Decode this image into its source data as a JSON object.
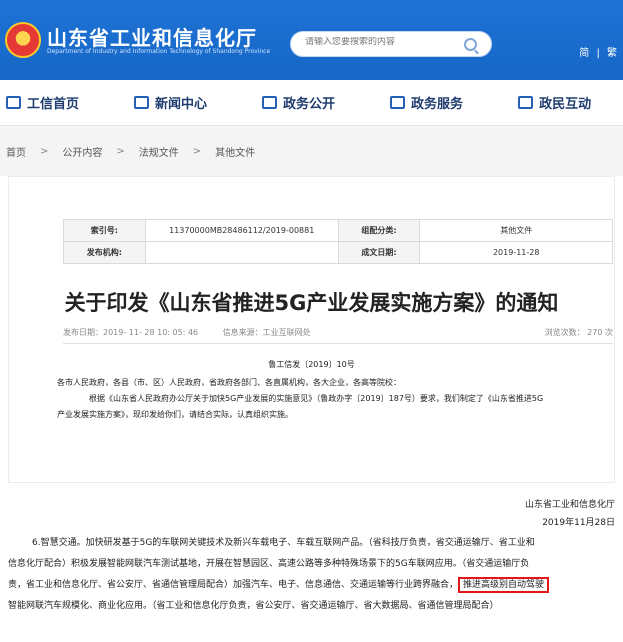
{
  "header": {
    "title": "山东省工业和信息化厅",
    "subtitle": "Department of Industry and Information Technology of Shandong Province",
    "search_placeholder": "请输入您要搜索的内容",
    "lang_links": [
      "简",
      "繁"
    ]
  },
  "nav": {
    "items": [
      {
        "label": "工信首页",
        "icon": "home-icon"
      },
      {
        "label": "新闻中心",
        "icon": "news-icon"
      },
      {
        "label": "政务公开",
        "icon": "monitor-icon"
      },
      {
        "label": "政务服务",
        "icon": "service-icon"
      },
      {
        "label": "政民互动",
        "icon": "interact-icon"
      }
    ]
  },
  "breadcrumb": [
    "首页",
    "公开内容",
    "法规文件",
    "其他文件"
  ],
  "meta": {
    "index_label": "索引号:",
    "index_value": "11370000MB28486112/2019-00881",
    "category_label": "组配分类:",
    "category_value": "其他文件",
    "issuer_label": "发布机构:",
    "issuer_value": "",
    "date_label": "成文日期:",
    "date_value": "2019-11-28"
  },
  "article": {
    "title": "关于印发《山东省推进5G产业发展实施方案》的通知",
    "publish_time": "发布日期：2019- 11- 28 10: 05: 46",
    "source": "信息来源：工业互联网处",
    "views": "浏览次数： 270   次",
    "doc_no": "鲁工信发〔2019〕10号",
    "salutation": "各市人民政府，各县（市、区）人民政府，省政府各部门、各直属机构，各大企业，各高等院校：",
    "body_line1": "根据《山东省人民政府办公厅关于加快5G产业发展的实施意见》（鲁政办字〔2019〕187号）要求，我们制定了《山东省推进5G",
    "body_line2": "产业发展实施方案》，现印发给你们，请结合实际，认真组织实施。"
  },
  "signature": {
    "org": "山东省工业和信息化厅",
    "date": "2019年11月28日"
  },
  "excerpt": {
    "line1": "6.智慧交通。加快研发基于5G的车联网关键技术及新兴车载电子、车载互联网产品。（省科技厅负责，省交通运输厅、省工业和",
    "line2": "信息化厅配合）积极发展智能网联汽车测试基地，开展在智慧园区、高速公路等多种特殊场景下的5G车联网应用。（省交通运输厅负",
    "line3": "责，省工业和信息化厅、省公安厅、省通信管理局配合）加强汽车、电子、信息通信、交通运输等行业跨界融合，",
    "highlight": "推进高级别自动驾驶",
    "line4": "智能网联汽车规模化、商业化应用。（省工业和信息化厅负责，省公安厅、省交通运输厅、省大数据局、省通信管理局配合）"
  },
  "colors": {
    "header_blue": "#1667c6",
    "nav_text": "#1f3c6e",
    "highlight_border": "#e01818"
  }
}
